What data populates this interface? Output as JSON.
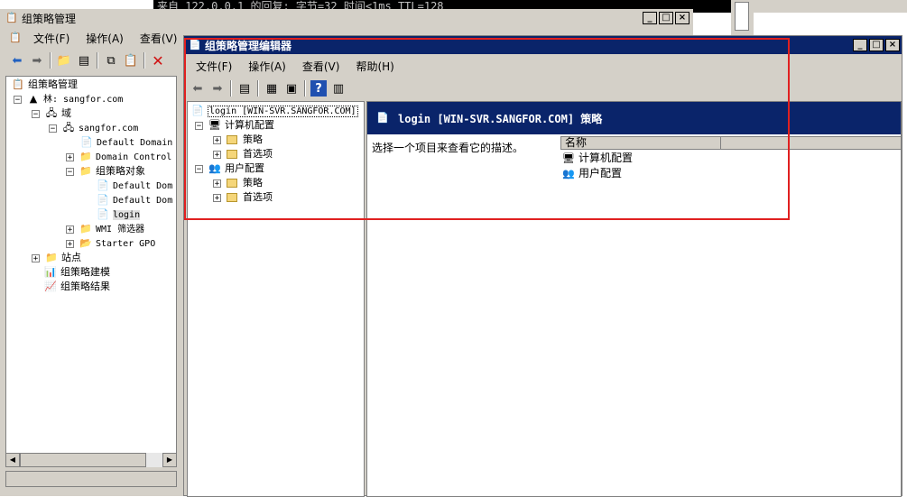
{
  "bg_console": {
    "text": "来自 122.0.0.1 的回复: 字节=32 时间<1ms TTL=128"
  },
  "gpmc": {
    "title": "组策略管理",
    "menu": [
      "文件(F)",
      "操作(A)",
      "查看(V)"
    ],
    "tree": {
      "root": "组策略管理",
      "forest": "林: sangfor.com",
      "domains": "域",
      "domain": "sangfor.com",
      "default_domain": "Default Domain",
      "domain_controllers": "Domain Control",
      "gpo_objects": "组策略对象",
      "gpo1": "Default Dom",
      "gpo2": "Default Dom",
      "gpo3": "login",
      "wmi": "WMI 筛选器",
      "starter": "Starter GPO",
      "sites": "站点",
      "modeling": "组策略建模",
      "results": "组策略结果"
    }
  },
  "editor": {
    "title": "组策略管理编辑器",
    "menu": [
      "文件(F)",
      "操作(A)",
      "查看(V)",
      "帮助(H)"
    ],
    "tree": {
      "root": "login [WIN-SVR.SANGFOR.COM]",
      "computer_config": "计算机配置",
      "policies": "策略",
      "preferences": "首选项",
      "user_config": "用户配置",
      "policies2": "策略",
      "preferences2": "首选项"
    },
    "header": "login [WIN-SVR.SANGFOR.COM] 策略",
    "description": "选择一个项目来查看它的描述。",
    "column_name": "名称",
    "items": [
      "计算机配置",
      "用户配置"
    ]
  },
  "colors": {
    "title_active": "#0a246a",
    "highlight": "#e02020",
    "chrome": "#d4d0c8"
  }
}
